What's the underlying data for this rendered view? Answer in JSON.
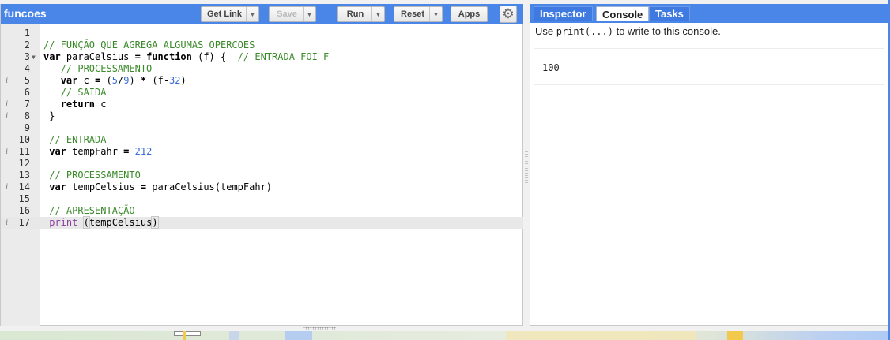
{
  "editor": {
    "script_name": "funcoes",
    "buttons": {
      "get_link": "Get Link",
      "save": "Save",
      "run": "Run",
      "reset": "Reset",
      "apps": "Apps"
    },
    "lines": [
      {
        "n": "1",
        "info": false,
        "fold": false,
        "html": ""
      },
      {
        "n": "2",
        "info": false,
        "fold": false,
        "html": "<span class=\"cm\">// FUNÇÃO QUE AGREGA ALGUMAS OPERCOES</span>"
      },
      {
        "n": "3",
        "info": false,
        "fold": true,
        "html": "<span class=\"kw\">var</span> paraCelsius <span class=\"kw\">=</span> <span class=\"kw\">function</span> (f) {  <span class=\"cm\">// ENTRADA FOI F</span>"
      },
      {
        "n": "4",
        "info": false,
        "fold": false,
        "html": "   <span class=\"cm\">// PROCESSAMENTO</span>"
      },
      {
        "n": "5",
        "info": true,
        "fold": false,
        "html": "   <span class=\"kw\">var</span> c <span class=\"kw\">=</span> (<span class=\"num\">5</span>/<span class=\"num\">9</span>) <span class=\"kw\">*</span> (f-<span class=\"num\">32</span>)"
      },
      {
        "n": "6",
        "info": false,
        "fold": false,
        "html": "   <span class=\"cm\">// SAIDA</span>"
      },
      {
        "n": "7",
        "info": true,
        "fold": false,
        "html": "   <span class=\"kw\">return</span> c"
      },
      {
        "n": "8",
        "info": true,
        "fold": false,
        "html": " }"
      },
      {
        "n": "9",
        "info": false,
        "fold": false,
        "html": ""
      },
      {
        "n": "10",
        "info": false,
        "fold": false,
        "html": " <span class=\"cm\">// ENTRADA</span>"
      },
      {
        "n": "11",
        "info": true,
        "fold": false,
        "html": " <span class=\"kw\">var</span> tempFahr <span class=\"kw\">=</span> <span class=\"num\">212</span>"
      },
      {
        "n": "12",
        "info": false,
        "fold": false,
        "html": ""
      },
      {
        "n": "13",
        "info": false,
        "fold": false,
        "html": " <span class=\"cm\">// PROCESSAMENTO</span>"
      },
      {
        "n": "14",
        "info": true,
        "fold": false,
        "html": " <span class=\"kw\">var</span> tempCelsius <span class=\"kw\">=</span> paraCelsius(tempFahr)"
      },
      {
        "n": "15",
        "info": false,
        "fold": false,
        "html": ""
      },
      {
        "n": "16",
        "info": false,
        "fold": false,
        "html": " <span class=\"cm\">// APRESENTAÇÃO</span>"
      },
      {
        "n": "17",
        "info": true,
        "fold": false,
        "active": true,
        "html": " <span class=\"pr\">print</span> <span class=\"bracket\">(</span>tempCelsius<span class=\"bracket\">)</span><span class=\"cursor\"></span>"
      }
    ]
  },
  "panel": {
    "tabs": [
      "Inspector",
      "Console",
      "Tasks"
    ],
    "active_tab": "Console",
    "hint_prefix": "Use ",
    "hint_code": "print(...)",
    "hint_suffix": " to write to this console.",
    "output": [
      "100"
    ]
  }
}
